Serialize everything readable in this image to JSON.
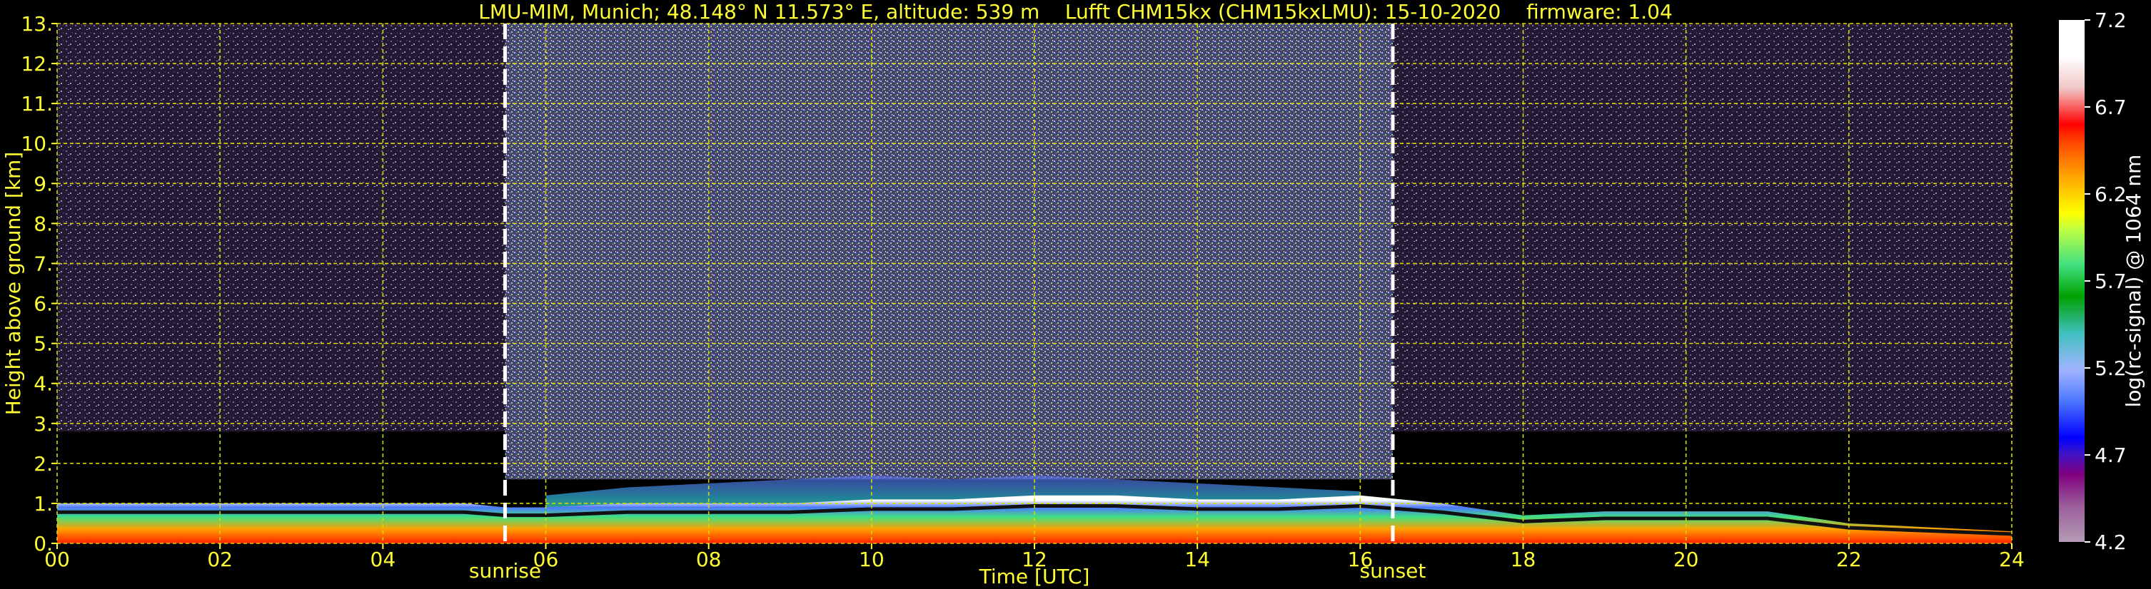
{
  "chart_data": {
    "type": "heatmap",
    "title": "LMU-MIM, Munich; 48.148° N 11.573° E, altitude: 539 m    Lufft CHM15kx (CHM15kxLMU): 15-10-2020    firmware: 1.04",
    "xlabel": "Time [UTC]",
    "ylabel": "Height above ground [km]",
    "xlim": [
      0,
      24
    ],
    "ylim": [
      0,
      13
    ],
    "x_ticks": [
      "00",
      "02",
      "04",
      "06",
      "08",
      "10",
      "12",
      "14",
      "16",
      "18",
      "20",
      "22",
      "24"
    ],
    "y_ticks": [
      "0.",
      "1.",
      "2.",
      "3.",
      "4.",
      "5.",
      "6.",
      "7.",
      "8.",
      "9.",
      "10.",
      "11.",
      "12.",
      "13."
    ],
    "grid": true,
    "markers": [
      {
        "label": "sunrise",
        "x": 5.5
      },
      {
        "label": "sunset",
        "x": 16.4
      }
    ],
    "colorbar": {
      "label": "log(rc-signal) @ 1064 nm",
      "range": [
        4.2,
        7.2
      ],
      "ticks": [
        "4.2",
        "4.7",
        "5.2",
        "5.7",
        "6.2",
        "6.7",
        "7.2"
      ]
    },
    "boundary_layer_top_km": [
      {
        "x": 0,
        "y": 1.0
      },
      {
        "x": 1,
        "y": 1.0
      },
      {
        "x": 2,
        "y": 1.0
      },
      {
        "x": 3,
        "y": 1.0
      },
      {
        "x": 4,
        "y": 1.0
      },
      {
        "x": 5,
        "y": 1.0
      },
      {
        "x": 5.5,
        "y": 0.9
      },
      {
        "x": 6,
        "y": 0.9
      },
      {
        "x": 7,
        "y": 1.0
      },
      {
        "x": 8,
        "y": 1.0
      },
      {
        "x": 9,
        "y": 1.0
      },
      {
        "x": 10,
        "y": 1.1
      },
      {
        "x": 11,
        "y": 1.1
      },
      {
        "x": 12,
        "y": 1.2
      },
      {
        "x": 13,
        "y": 1.2
      },
      {
        "x": 14,
        "y": 1.1
      },
      {
        "x": 15,
        "y": 1.1
      },
      {
        "x": 16,
        "y": 1.2
      },
      {
        "x": 17,
        "y": 1.0
      },
      {
        "x": 18,
        "y": 0.7
      },
      {
        "x": 19,
        "y": 0.8
      },
      {
        "x": 20,
        "y": 0.8
      },
      {
        "x": 21,
        "y": 0.8
      },
      {
        "x": 22,
        "y": 0.5
      },
      {
        "x": 23,
        "y": 0.4
      },
      {
        "x": 24,
        "y": 0.3
      }
    ],
    "aerosol_layer_top_km": [
      {
        "x": 6,
        "y": 1.2
      },
      {
        "x": 7,
        "y": 1.4
      },
      {
        "x": 8,
        "y": 1.5
      },
      {
        "x": 9,
        "y": 1.6
      },
      {
        "x": 10,
        "y": 1.7
      },
      {
        "x": 11,
        "y": 1.6
      },
      {
        "x": 12,
        "y": 1.7
      },
      {
        "x": 13,
        "y": 1.6
      },
      {
        "x": 14,
        "y": 1.5
      },
      {
        "x": 15,
        "y": 1.4
      },
      {
        "x": 16,
        "y": 1.3
      }
    ],
    "high_noise_period": [
      5.5,
      16.4
    ],
    "colors": {
      "background": "#000000",
      "text": "#ffff33",
      "grid": "#d8d800",
      "marker": "#ffffff"
    }
  }
}
